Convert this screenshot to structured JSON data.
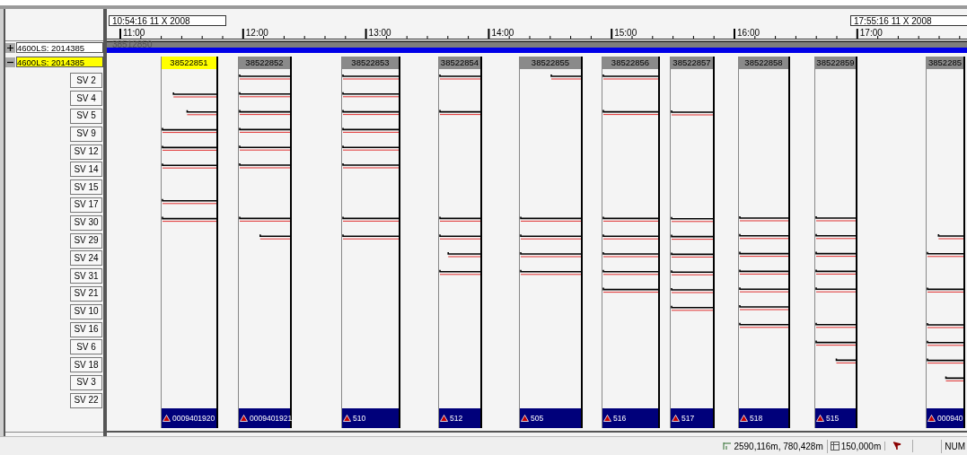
{
  "timeline": {
    "start_time": "10:54:16 11 X 2008",
    "end_time": "17:55:16 11 X 2008",
    "hours": [
      "11:00",
      "12:00",
      "13:00",
      "14:00",
      "15:00",
      "16:00",
      "17:00"
    ]
  },
  "groups": [
    {
      "label": "4600LS: 2014385",
      "expanded": false,
      "selected": false,
      "bar_label": "38512850"
    },
    {
      "label": "4600LS: 2014385",
      "expanded": true,
      "selected": true
    }
  ],
  "satellites": [
    "SV 2",
    "SV 4",
    "SV 5",
    "SV 9",
    "SV 12",
    "SV 14",
    "SV 15",
    "SV 17",
    "SV 30",
    "SV 29",
    "SV 24",
    "SV 31",
    "SV 21",
    "SV 10",
    "SV 16",
    "SV 6",
    "SV 18",
    "SV 3",
    "SV 22"
  ],
  "passes": [
    {
      "label": "38522851",
      "station": "0009401920",
      "selected": true
    },
    {
      "label": "38522852",
      "station": "0009401921",
      "selected": false
    },
    {
      "label": "38522853",
      "station": "510",
      "selected": false
    },
    {
      "label": "38522854",
      "station": "512",
      "selected": false
    },
    {
      "label": "38522855",
      "station": "505",
      "selected": false
    },
    {
      "label": "38522856",
      "station": "516",
      "selected": false
    },
    {
      "label": "38522857",
      "station": "517",
      "selected": false
    },
    {
      "label": "38522858",
      "station": "518",
      "selected": false
    },
    {
      "label": "38522859",
      "station": "515",
      "selected": false
    },
    {
      "label": "3852285",
      "station": "000940",
      "selected": false
    }
  ],
  "status_bar": {
    "position": "2590,116m, 780,428m",
    "scale": "150,000m",
    "num": "NUM"
  }
}
